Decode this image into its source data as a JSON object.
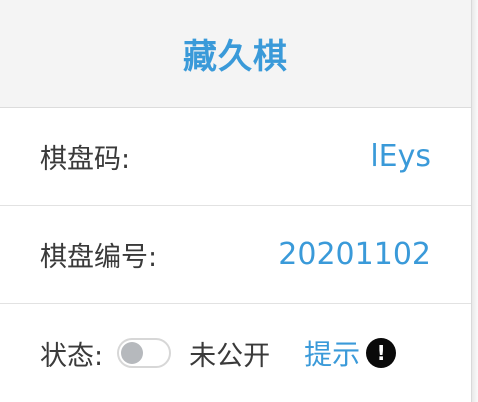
{
  "header": {
    "title": "藏久棋"
  },
  "rows": {
    "board_code": {
      "label": "棋盘码:",
      "value": "lEys"
    },
    "board_number": {
      "label": "棋盘编号:",
      "value": "20201102"
    },
    "status": {
      "label": "状态:",
      "toggle_on": false,
      "toggle_text": "未公开",
      "hint_label": "提示",
      "hint_icon": "exclamation-circle-icon",
      "hint_icon_glyph": "!"
    }
  },
  "colors": {
    "accent": "#3a9ad9",
    "text": "#3a3a3a",
    "header_bg": "#f4f4f4",
    "toggle_knob": "#b6b9bd"
  }
}
